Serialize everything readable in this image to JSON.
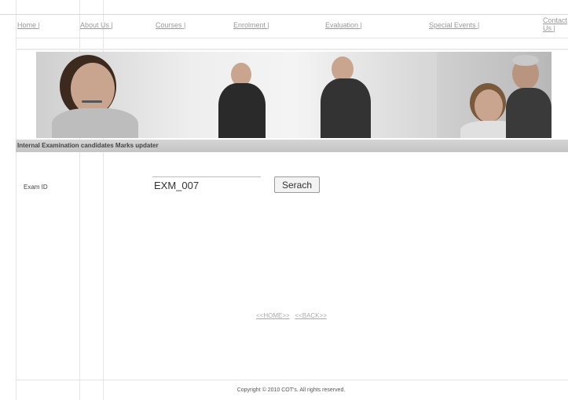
{
  "nav": {
    "items": [
      {
        "label": "Home |"
      },
      {
        "label": "About Us |"
      },
      {
        "label": "Courses |"
      },
      {
        "label": "Enrolment |"
      },
      {
        "label": "Evaluation |"
      },
      {
        "label": "Special Events |"
      },
      {
        "label": "Contact Us |"
      }
    ]
  },
  "section": {
    "title": "Internal Examination candidates Marks updater"
  },
  "form": {
    "exam_id_label": "Exam ID",
    "exam_id_value": "EXM_007",
    "search_label": "Serach"
  },
  "links": {
    "home": "<<HOME>>",
    "back": "<<BACK>>"
  },
  "footer": {
    "copyright": "Copyright © 2010 COT's. All rights reserved."
  },
  "colors": {
    "title_bar": "#c8c8c8",
    "nav_text": "#9a9a9a"
  }
}
